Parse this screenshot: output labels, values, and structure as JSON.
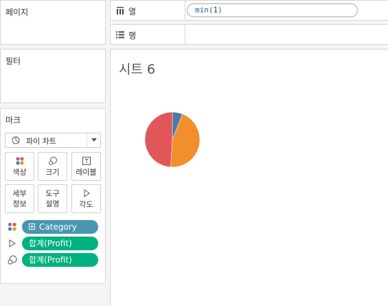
{
  "pages": {
    "title": "페이지"
  },
  "filters": {
    "title": "필터"
  },
  "marks": {
    "title": "마크",
    "mark_type": "파이 차트",
    "buttons": {
      "color": "색상",
      "size": "크기",
      "label": "레이블",
      "detail": [
        "세부",
        "정보"
      ],
      "tooltip": [
        "도구",
        "설명"
      ],
      "angle": "각도"
    },
    "pills": [
      {
        "field": "Category",
        "role": "color",
        "color": "#4996b2"
      },
      {
        "field": "합계(Profit)",
        "role": "angle",
        "color": "#00b180"
      },
      {
        "field": "합계(Profit)",
        "role": "size",
        "color": "#00b180"
      }
    ]
  },
  "columns_shelf": {
    "label": "열",
    "pill": {
      "func": "min",
      "arg": "1"
    }
  },
  "rows_shelf": {
    "label": "행"
  },
  "sheet": {
    "title": "시트 6"
  },
  "chart_data": {
    "type": "pie",
    "series": [
      {
        "name": "",
        "values": [
          0.06,
          0.45,
          0.49
        ]
      }
    ],
    "colors": [
      "#4e79a7",
      "#f28e2b",
      "#e15759"
    ]
  }
}
